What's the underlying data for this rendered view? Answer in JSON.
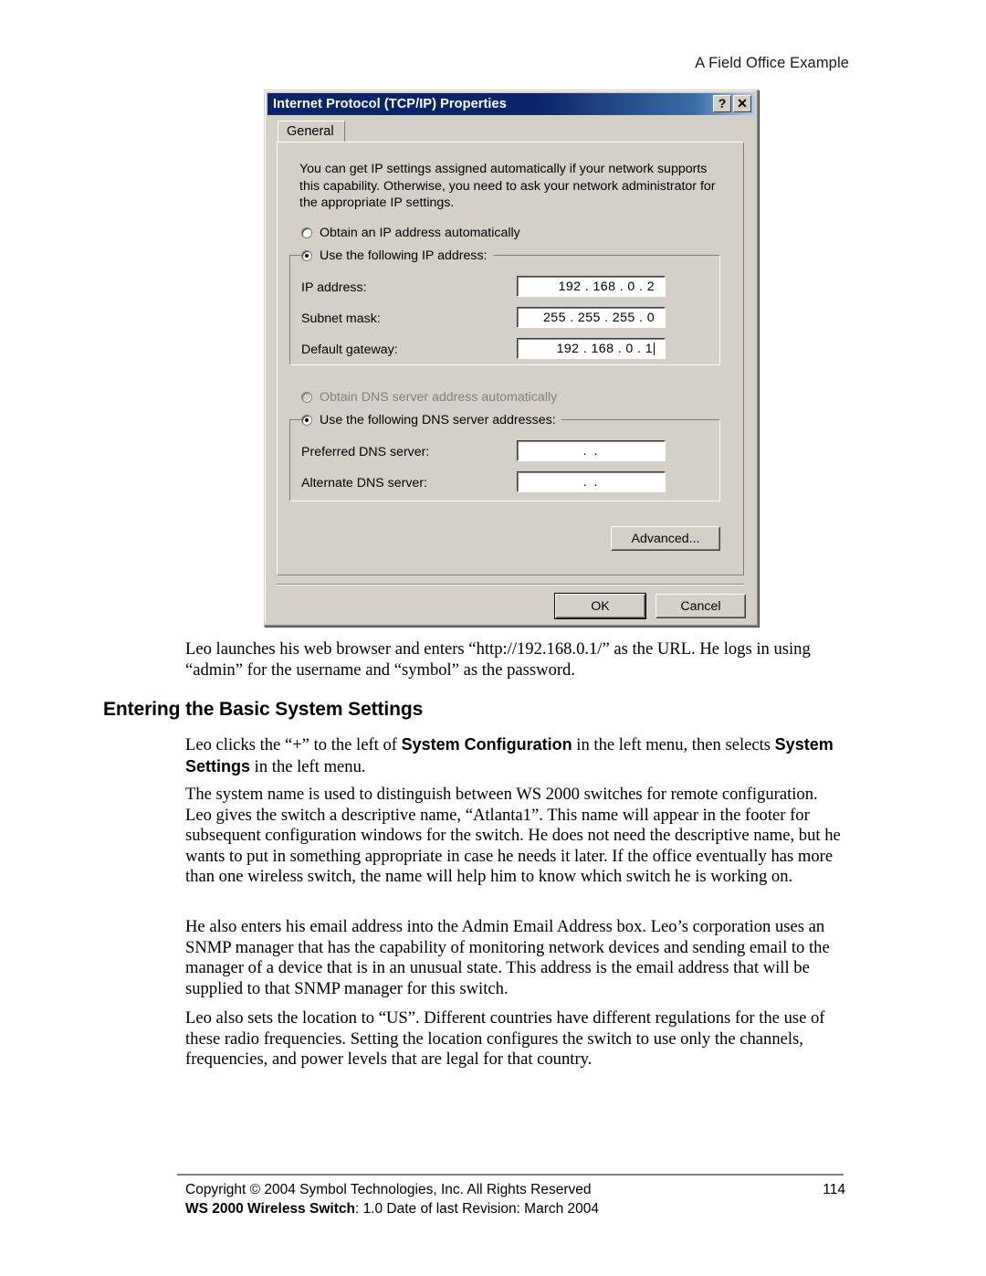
{
  "page": {
    "header": "A Field Office Example"
  },
  "dialog": {
    "title": "Internet Protocol (TCP/IP) Properties",
    "help_button": "?",
    "close_button": "✕",
    "tab": "General",
    "description": "You can get IP settings assigned automatically if your network supports this capability. Otherwise, you need to ask your network administrator for the appropriate IP settings.",
    "ip_auto_radio": "Obtain an IP address automatically",
    "ip_manual_radio": "Use the following IP address:",
    "ip_address_label": "IP address:",
    "ip_address_value": "192 . 168 .  0  .  2",
    "subnet_label": "Subnet mask:",
    "subnet_value": "255 . 255 . 255 .  0",
    "gateway_label": "Default gateway:",
    "gateway_value": "192 . 168 .  0  .  1",
    "dns_auto_radio": "Obtain DNS server address automatically",
    "dns_manual_radio": "Use the following DNS server addresses:",
    "preferred_dns_label": "Preferred DNS server:",
    "preferred_dns_value": ".    .",
    "alternate_dns_label": "Alternate DNS server:",
    "alternate_dns_value": ".    .",
    "advanced_button": "Advanced...",
    "ok_button": "OK",
    "cancel_button": "Cancel",
    "titlebar_color": "#0a246a",
    "face_color": "#d4d0c8"
  },
  "content": {
    "para_browser": "Leo launches his web browser and enters “http://192.168.0.1/” as the URL. He logs in using “admin” for the username and “symbol” as the password.",
    "heading": "Entering the Basic System Settings",
    "para_clicks_pre": "Leo clicks the “+” to the left of ",
    "para_clicks_bold1": "System Configuration",
    "para_clicks_mid": " in the left menu, then selects ",
    "para_clicks_bold2": "System Settings",
    "para_clicks_post": " in the left menu.",
    "para_systemname": "The system name is used to distinguish between WS 2000 switches for remote configuration. Leo gives the switch a descriptive name, “Atlanta1”. This name will appear in the footer for subsequent configuration windows for the switch. He does not need the descriptive name, but he wants to put in something appropriate in case he needs it later. If the office eventually has more than one wireless switch, the name will help him to know which switch he is working on.",
    "para_email": "He also enters his email address into the Admin Email Address box. Leo’s corporation uses an SNMP manager that has the capability of monitoring network devices and sending email to the manager of a device that is in an unusual state. This address is the email address that will be supplied to that SNMP manager for this switch.",
    "para_location": "Leo also sets the location to “US”. Different countries have different regulations for the use of these radio frequencies. Setting the location configures the switch to use only the channels, frequencies, and power levels that are legal for that country."
  },
  "footer": {
    "copyright": "Copyright © 2004 Symbol Technologies, Inc. All Rights Reserved",
    "page_number": "114",
    "product_bold": "WS 2000 Wireless Switch",
    "revision": ": 1.0  Date of last Revision: March 2004"
  }
}
